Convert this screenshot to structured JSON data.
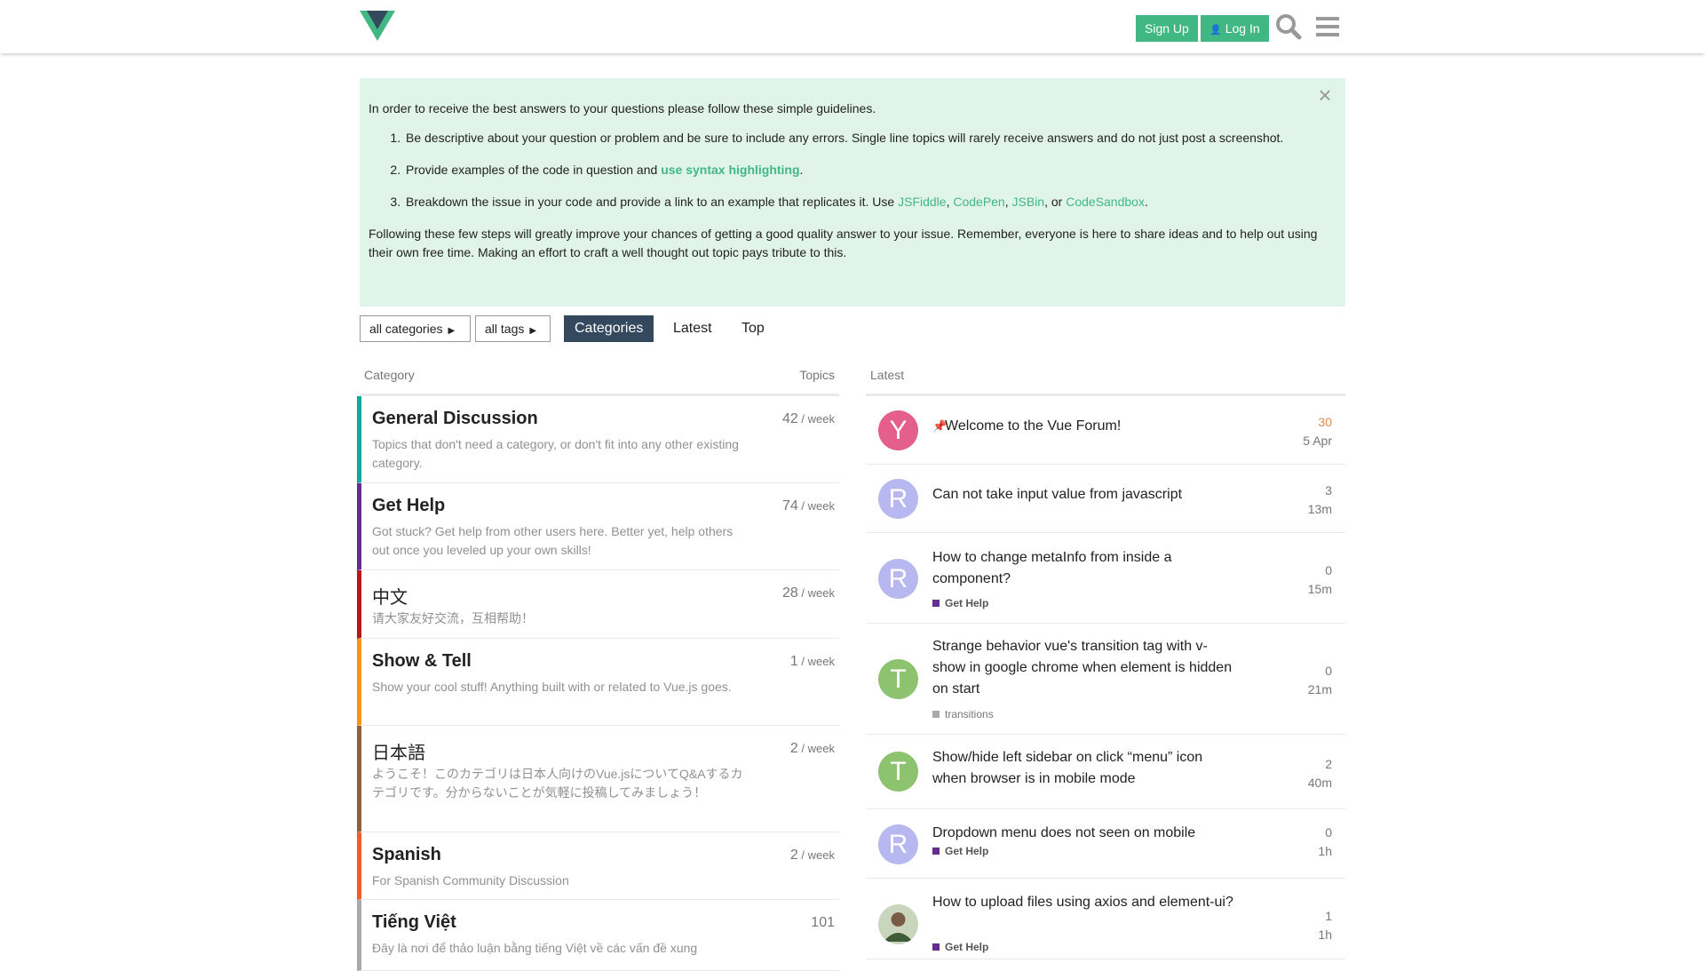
{
  "header": {
    "signup_label": "Sign Up",
    "login_label": "Log In",
    "brand_colors": {
      "green": "#41b883",
      "dark": "#34495e"
    },
    "icons": [
      "vue-logo-icon",
      "user-icon",
      "search-icon",
      "hamburger-menu-icon"
    ]
  },
  "notice": {
    "intro": "In order to receive the best answers to your questions please follow these simple guidelines.",
    "items": [
      {
        "text": "Be descriptive about your question or problem and be sure to include any errors. Single line topics will rarely receive answers and do not just post a screenshot."
      },
      {
        "text_before": "Provide examples of the code in question and ",
        "link": "use syntax highlighting",
        "text_after": "."
      },
      {
        "text_before": "Breakdown the issue in your code and provide a link to an example that replicates it. Use ",
        "links": [
          "JSFiddle",
          "CodePen",
          "JSBin",
          "CodeSandbox"
        ],
        "sep1": ", ",
        "sep2": ", ",
        "sep3": ", or ",
        "text_after": "."
      }
    ],
    "outro": "Following these few steps will greatly improve your chances of getting a good quality answer to your issue. Remember, everyone is here to share ideas and to help out using their own free time. Making an effort to craft a well thought out topic pays tribute to this.",
    "close_glyph": "×"
  },
  "nav": {
    "categories_dropdown": "all categories",
    "tags_dropdown": "all tags",
    "tabs": [
      "Categories",
      "Latest",
      "Top"
    ],
    "active_tab": "Categories"
  },
  "categories": {
    "header_category": "Category",
    "header_topics": "Topics",
    "rows": [
      {
        "name": "General Discussion",
        "desc": "Topics that don't need a category, or don't fit into any other existing category.",
        "count": "42",
        "per": " / week",
        "color": "#12a89d"
      },
      {
        "name": "Get Help",
        "desc": "Got stuck? Get help from other users here. Better yet, help others out once you leveled up your own skills!",
        "count": "74",
        "per": " / week",
        "color": "#652d90"
      },
      {
        "name": "中文",
        "desc": "请大家友好交流，互相帮助！",
        "count": "28",
        "per": " / week",
        "color": "#b3181d"
      },
      {
        "name": "Show & Tell",
        "desc": "Show your cool stuff! Anything built with or related to Vue.js goes.",
        "count": "1",
        "per": " / week",
        "color": "#f7941d"
      },
      {
        "name": "日本語",
        "desc": "ようこそ！このカテゴリは日本人向けのVue.jsについてQ&Aするカテゴリです。分からないことが気軽に投稿してみましょう！",
        "count": "2",
        "per": " / week",
        "color": "#8c6238"
      },
      {
        "name": "Spanish",
        "desc": "For Spanish Community Discussion",
        "count": "2",
        "per": " / week",
        "color": "#ed5e2a"
      },
      {
        "name": "Tiếng Việt",
        "desc": "Đây là nơi để thảo luận bằng tiếng Việt về các vấn đề xung",
        "count": "101",
        "per": "",
        "color": "#aaaaaa"
      }
    ]
  },
  "latest": {
    "header": "Latest",
    "topics": [
      {
        "avatar": "Y",
        "avatar_color": "#e45f8c",
        "title": "Welcome to the Vue Forum!",
        "pinned": true,
        "badge": "",
        "replies": "30",
        "age": "5 Apr"
      },
      {
        "avatar": "R",
        "avatar_color": "#b8b8f0",
        "title": "Can not take input value from javascript",
        "pinned": false,
        "badge": "",
        "replies": "3",
        "age": "13m"
      },
      {
        "avatar": "R",
        "avatar_color": "#b8b8f0",
        "title": "How to change metaInfo from inside a component?",
        "pinned": false,
        "badge": "Get Help",
        "replies": "0",
        "age": "15m"
      },
      {
        "avatar": "T",
        "avatar_color": "#8dc26f",
        "title": "Strange behavior vue's transition tag with v-show in google chrome when element is hidden on start",
        "pinned": false,
        "badge": "transitions",
        "replies": "0",
        "age": "21m"
      },
      {
        "avatar": "T",
        "avatar_color": "#8dc26f",
        "title": "Show/hide left sidebar on click “menu” icon when browser is in mobile mode",
        "pinned": false,
        "badge": "",
        "replies": "2",
        "age": "40m"
      },
      {
        "avatar": "R",
        "avatar_color": "#b8b8f0",
        "title": "Dropdown menu does not seen on mobile",
        "pinned": false,
        "badge": "Get Help",
        "replies": "0",
        "age": "1h"
      },
      {
        "avatar": "",
        "avatar_color": "#4a6b3a",
        "title": "How to upload files using axios and element-ui?",
        "pinned": false,
        "badge": "Get Help",
        "replies": "1",
        "age": "1h"
      }
    ]
  }
}
